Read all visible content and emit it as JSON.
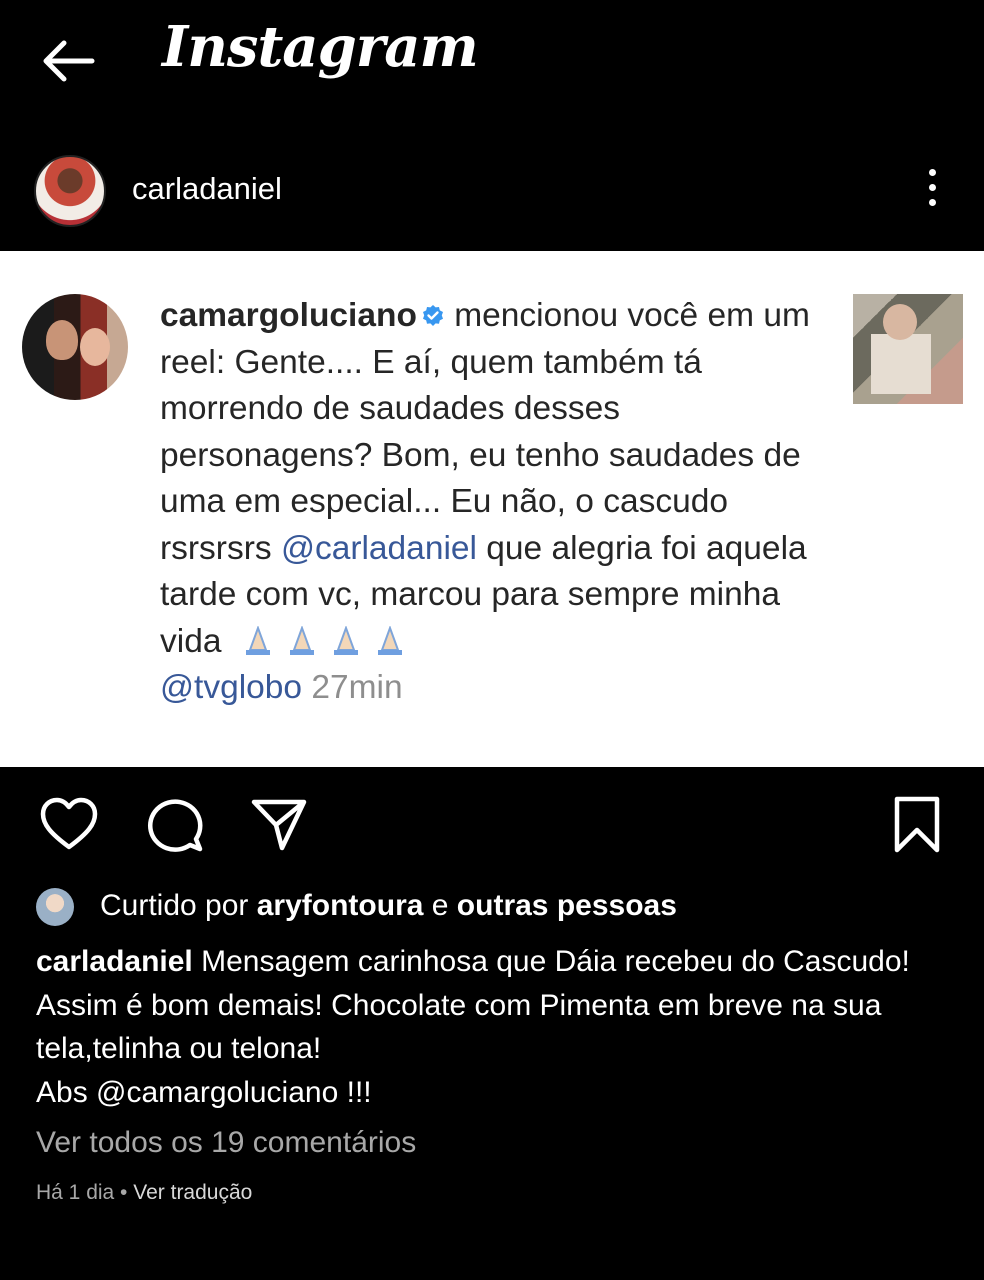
{
  "topbar": {
    "title": "Instagram"
  },
  "post": {
    "username": "carladaniel"
  },
  "notification": {
    "username": "camargoluciano",
    "action": " mencionou você em um reel: ",
    "text1": "Gente.... E aí, quem também tá morrendo de saudades desses personagens? Bom, eu tenho saudades de uma em especial... Eu não,  o cascudo rsrsrsrs",
    "mention1": "@carladaniel",
    "text2": " que alegria foi aquela tarde com vc, marcou para sempre minha vida",
    "mention2": "@tvglobo",
    "time": " 27min"
  },
  "likes": {
    "prefix": "Curtido por ",
    "user": "aryfontoura",
    "middle": " e ",
    "others": "outras pessoas"
  },
  "caption": {
    "username": "carladaniel",
    "line1": " Mensagem carinhosa que Dáia recebeu do Cascudo!",
    "line2": "Assim é bom demais! Chocolate com Pimenta em breve na sua tela,telinha ou telona!",
    "line3": "Abs @camargoluciano !!!"
  },
  "comments_link": "Ver todos os 19 comentários",
  "meta": {
    "time": "Há 1 dia",
    "sep": " • ",
    "translate": "Ver tradução"
  },
  "icons": [
    "back-arrow-icon",
    "kebab-menu-icon",
    "verified-badge-icon",
    "heart-icon",
    "comment-icon",
    "share-icon",
    "bookmark-icon",
    "praying-hands-emoji"
  ]
}
